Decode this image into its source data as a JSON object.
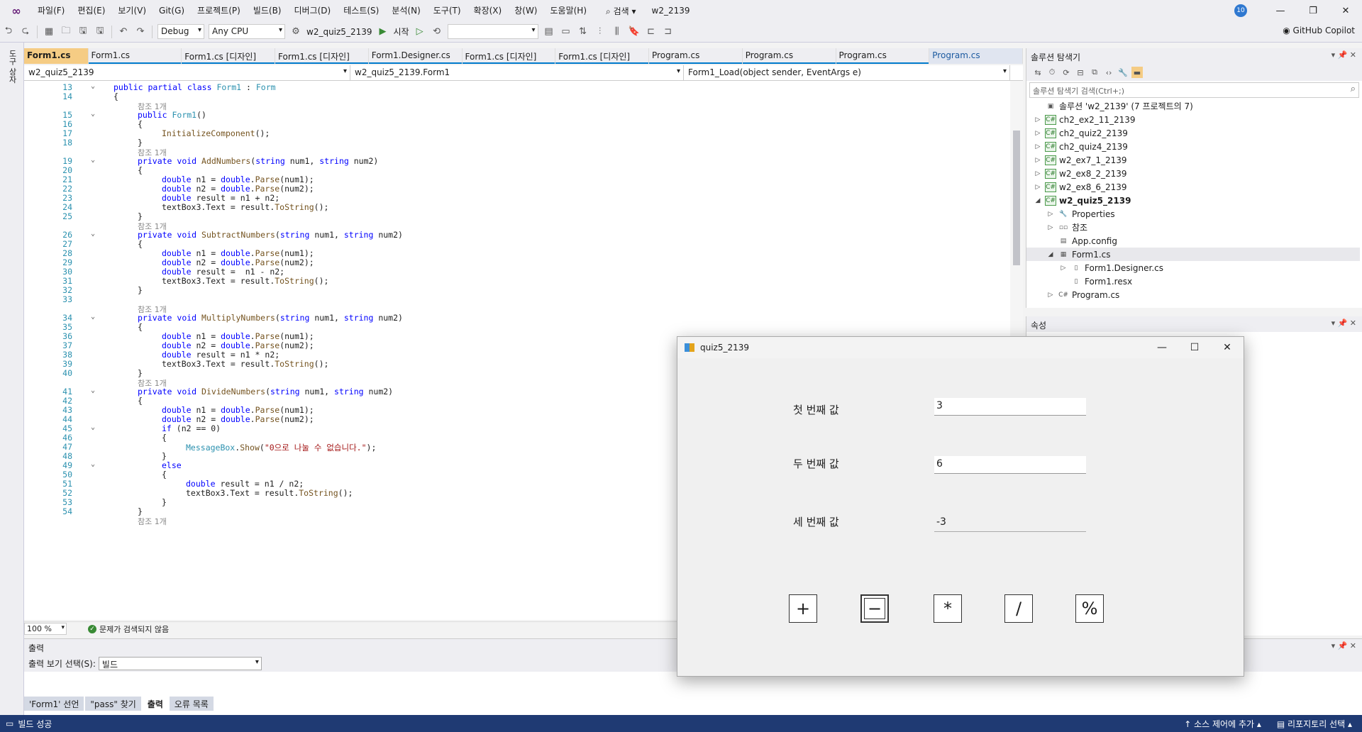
{
  "menu": [
    "파일(F)",
    "편집(E)",
    "보기(V)",
    "Git(G)",
    "프로젝트(P)",
    "빌드(B)",
    "디버그(D)",
    "테스트(S)",
    "분석(N)",
    "도구(T)",
    "확장(X)",
    "창(W)",
    "도움말(H)"
  ],
  "search_label": "검색",
  "solution_title": "w2_2139",
  "notif_count": "10",
  "toolbar": {
    "config": "Debug",
    "platform": "Any CPU",
    "project": "w2_quiz5_2139",
    "start": "시작",
    "copilot": "GitHub Copilot"
  },
  "left_strip": "도구 상자",
  "tabs": [
    "Form1.cs",
    "Form1.cs",
    "Form1.cs [디자인]",
    "Form1.cs [디자인]",
    "Form1.Designer.cs",
    "Form1.cs [디자인]",
    "Form1.cs [디자인]",
    "Program.cs",
    "Program.cs",
    "Program.cs",
    "Program.cs"
  ],
  "nav": {
    "project": "w2_quiz5_2139",
    "class": "w2_quiz5_2139.Form1",
    "member": "Form1_Load(object sender, EventArgs e)"
  },
  "code_lines": [
    {
      "ln": "13",
      "fold": true,
      "ind": 0,
      "t": "public partial class Form1 : Form"
    },
    {
      "ln": "14",
      "ind": 0,
      "t": "{"
    },
    {
      "ref": "참조 1개",
      "ind": 1
    },
    {
      "ln": "15",
      "fold": true,
      "ind": 1,
      "t": "public Form1()"
    },
    {
      "ln": "16",
      "ind": 1,
      "t": "{"
    },
    {
      "ln": "17",
      "ind": 2,
      "t": "InitializeComponent();"
    },
    {
      "ln": "18",
      "ind": 1,
      "t": "}"
    },
    {
      "ref": "참조 1개",
      "ind": 1
    },
    {
      "ln": "19",
      "fold": true,
      "ind": 1,
      "t": "private void AddNumbers(string num1, string num2)"
    },
    {
      "ln": "20",
      "ind": 1,
      "t": "{"
    },
    {
      "ln": "21",
      "ind": 2,
      "t": "double n1 = double.Parse(num1);"
    },
    {
      "ln": "22",
      "ind": 2,
      "t": "double n2 = double.Parse(num2);"
    },
    {
      "ln": "23",
      "ind": 2,
      "t": "double result = n1 + n2;"
    },
    {
      "ln": "24",
      "ind": 2,
      "t": "textBox3.Text = result.ToString();"
    },
    {
      "ln": "25",
      "ind": 1,
      "t": "}"
    },
    {
      "ref": "참조 1개",
      "ind": 1
    },
    {
      "ln": "26",
      "fold": true,
      "ind": 1,
      "t": "private void SubtractNumbers(string num1, string num2)"
    },
    {
      "ln": "27",
      "ind": 1,
      "t": "{"
    },
    {
      "ln": "28",
      "ind": 2,
      "t": "double n1 = double.Parse(num1);"
    },
    {
      "ln": "29",
      "ind": 2,
      "t": "double n2 = double.Parse(num2);"
    },
    {
      "ln": "30",
      "ind": 2,
      "t": "double result =  n1 - n2;"
    },
    {
      "ln": "31",
      "ind": 2,
      "t": "textBox3.Text = result.ToString();"
    },
    {
      "ln": "32",
      "ind": 1,
      "t": "}"
    },
    {
      "ln": "33",
      "ind": 1,
      "t": ""
    },
    {
      "ref": "참조 1개",
      "ind": 1
    },
    {
      "ln": "34",
      "fold": true,
      "ind": 1,
      "t": "private void MultiplyNumbers(string num1, string num2)"
    },
    {
      "ln": "35",
      "ind": 1,
      "t": "{"
    },
    {
      "ln": "36",
      "ind": 2,
      "t": "double n1 = double.Parse(num1);"
    },
    {
      "ln": "37",
      "ind": 2,
      "t": "double n2 = double.Parse(num2);"
    },
    {
      "ln": "38",
      "ind": 2,
      "t": "double result = n1 * n2;"
    },
    {
      "ln": "39",
      "ind": 2,
      "t": "textBox3.Text = result.ToString();"
    },
    {
      "ln": "40",
      "ind": 1,
      "t": "}"
    },
    {
      "ref": "참조 1개",
      "ind": 1
    },
    {
      "ln": "41",
      "fold": true,
      "ind": 1,
      "t": "private void DivideNumbers(string num1, string num2)"
    },
    {
      "ln": "42",
      "ind": 1,
      "t": "{"
    },
    {
      "ln": "43",
      "ind": 2,
      "t": "double n1 = double.Parse(num1);"
    },
    {
      "ln": "44",
      "ind": 2,
      "t": "double n2 = double.Parse(num2);"
    },
    {
      "ln": "45",
      "fold": true,
      "ind": 2,
      "t": "if (n2 == 0)"
    },
    {
      "ln": "46",
      "ind": 2,
      "t": "{"
    },
    {
      "ln": "47",
      "ind": 3,
      "t": "MessageBox.Show(\"0으로 나눌 수 없습니다.\");"
    },
    {
      "ln": "48",
      "ind": 2,
      "t": "}"
    },
    {
      "ln": "49",
      "fold": true,
      "ind": 2,
      "t": "else"
    },
    {
      "ln": "50",
      "ind": 2,
      "t": "{"
    },
    {
      "ln": "51",
      "ind": 3,
      "t": "double result = n1 / n2;"
    },
    {
      "ln": "52",
      "ind": 3,
      "t": "textBox3.Text = result.ToString();"
    },
    {
      "ln": "53",
      "ind": 2,
      "t": "}"
    },
    {
      "ln": "54",
      "ind": 1,
      "t": "}"
    },
    {
      "ref": "참조 1개",
      "ind": 1
    }
  ],
  "status_line": {
    "zoom": "100 %",
    "problems": "문제가 검색되지 않음"
  },
  "output": {
    "title": "출력",
    "source_label": "출력 보기 선택(S):",
    "source_value": "빌드"
  },
  "bottom_tabs": [
    "'Form1' 선언",
    "\"pass\" 찾기",
    "출력",
    "오류 목록"
  ],
  "statusbar": {
    "left": "빌드 성공",
    "scm": "소스 제어에 추가",
    "repo": "리포지토리 선택"
  },
  "solution_explorer": {
    "title": "솔루션 탐색기",
    "search_placeholder": "솔루션 탐색기 검색(Ctrl+;)",
    "items": [
      {
        "label": "솔루션 'w2_2139' (7 프로젝트의 7)",
        "level": 0,
        "icon": "solution-icon",
        "tw": ""
      },
      {
        "label": "ch2_ex2_11_2139",
        "level": 0,
        "icon": "project-icon",
        "tw": "▷"
      },
      {
        "label": "ch2_quiz2_2139",
        "level": 0,
        "icon": "project-icon",
        "tw": "▷"
      },
      {
        "label": "ch2_quiz4_2139",
        "level": 0,
        "icon": "project-icon",
        "tw": "▷"
      },
      {
        "label": "w2_ex7_1_2139",
        "level": 0,
        "icon": "project-icon",
        "tw": "▷"
      },
      {
        "label": "w2_ex8_2_2139",
        "level": 0,
        "icon": "project-icon",
        "tw": "▷"
      },
      {
        "label": "w2_ex8_6_2139",
        "level": 0,
        "icon": "project-icon",
        "tw": "▷"
      },
      {
        "label": "w2_quiz5_2139",
        "level": 0,
        "icon": "project-icon",
        "tw": "◢",
        "bold": true
      },
      {
        "label": "Properties",
        "level": 1,
        "icon": "wrench-icon",
        "tw": "▷"
      },
      {
        "label": "참조",
        "level": 1,
        "icon": "references-icon",
        "tw": "▷"
      },
      {
        "label": "App.config",
        "level": 1,
        "icon": "config-icon",
        "tw": ""
      },
      {
        "label": "Form1.cs",
        "level": 1,
        "icon": "form-icon",
        "tw": "◢",
        "selected": true
      },
      {
        "label": "Form1.Designer.cs",
        "level": 2,
        "icon": "file-icon",
        "tw": "▷"
      },
      {
        "label": "Form1.resx",
        "level": 2,
        "icon": "file-icon",
        "tw": ""
      },
      {
        "label": "Program.cs",
        "level": 1,
        "icon": "csharp-icon",
        "tw": "▷"
      }
    ]
  },
  "properties": {
    "title": "속성"
  },
  "dialog": {
    "title": "quiz5_2139",
    "label1": "첫 번째 값",
    "label2": "두 번째 값",
    "label3": "세 번째 값",
    "value1": "3",
    "value2": "6",
    "value3": "-3",
    "ops": [
      "+",
      "−",
      "*",
      "/",
      "%"
    ]
  }
}
